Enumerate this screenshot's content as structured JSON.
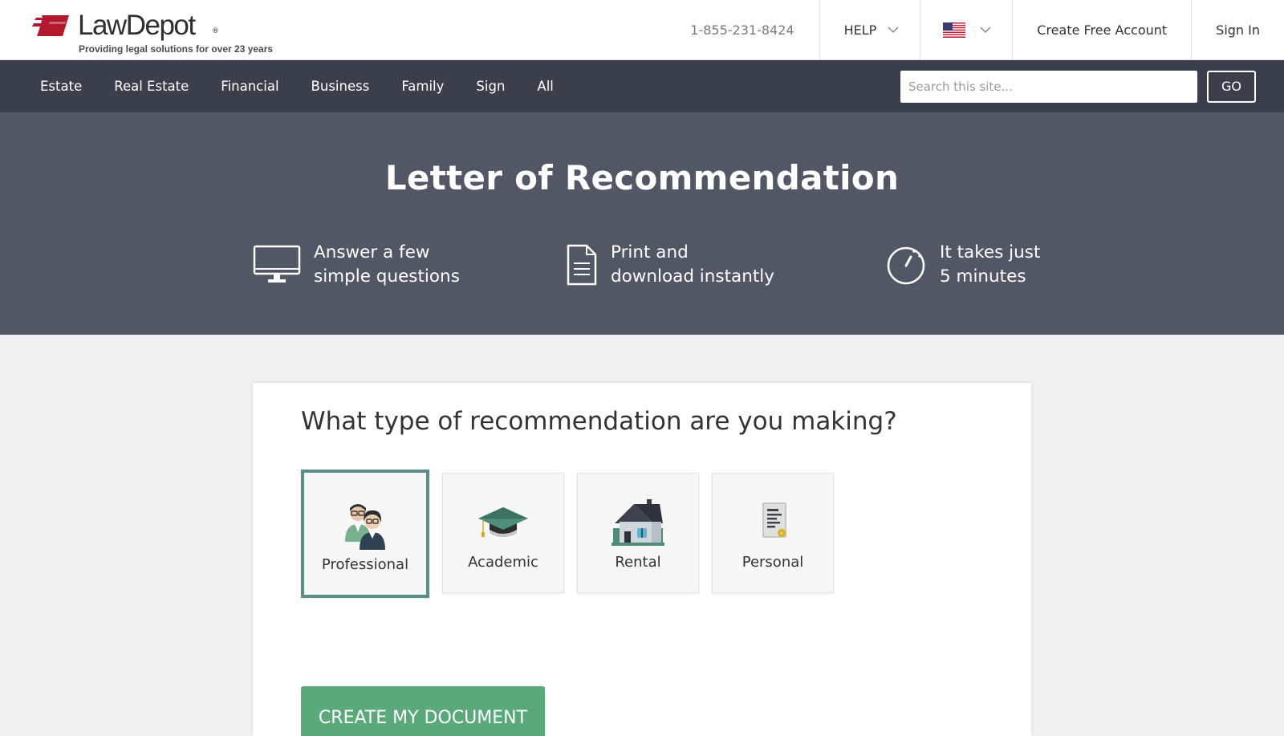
{
  "header": {
    "logo_text": "LawDepot",
    "logo_reg": "®",
    "tagline": "Providing legal solutions for over 23 years",
    "phone": "1-855-231-8424",
    "help_label": "HELP",
    "create_account": "Create Free Account",
    "sign_in": "Sign In"
  },
  "nav": {
    "items": [
      "Estate",
      "Real Estate",
      "Financial",
      "Business",
      "Family",
      "Sign",
      "All"
    ],
    "search_placeholder": "Search this site...",
    "go_label": "GO"
  },
  "hero": {
    "title": "Letter of Recommendation",
    "features": [
      {
        "icon": "monitor-icon",
        "line1": "Answer a few",
        "line2": "simple questions"
      },
      {
        "icon": "document-icon",
        "line1": "Print and",
        "line2": "download instantly"
      },
      {
        "icon": "stopwatch-icon",
        "line1": "It takes just",
        "line2": "5 minutes"
      }
    ]
  },
  "form": {
    "question": "What type of recommendation are you making?",
    "options": [
      {
        "label": "Professional",
        "icon": "professionals-icon",
        "selected": true
      },
      {
        "label": "Academic",
        "icon": "graduation-cap-icon",
        "selected": false
      },
      {
        "label": "Rental",
        "icon": "house-icon",
        "selected": false
      },
      {
        "label": "Personal",
        "icon": "certificate-icon",
        "selected": false
      }
    ],
    "cta_label": "CREATE MY DOCUMENT"
  },
  "colors": {
    "nav_bg": "#3a3f4b",
    "hero_bg": "#525766",
    "selected_border": "#5b8e89",
    "cta_bg": "#5aa97b",
    "logo_red": "#b3192e"
  }
}
